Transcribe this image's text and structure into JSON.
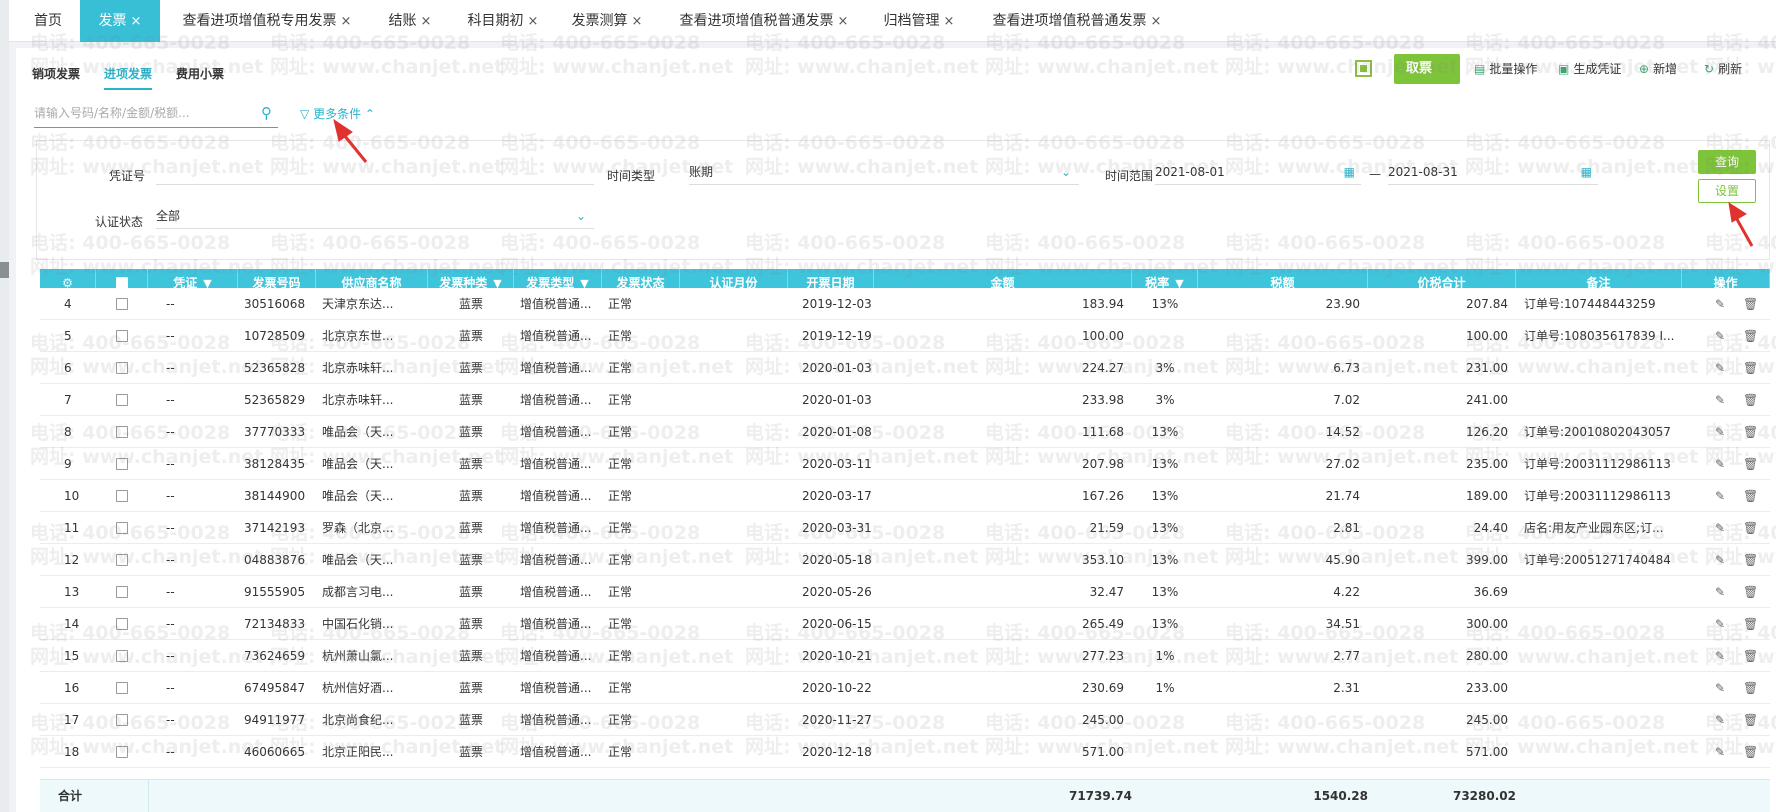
{
  "tabs": [
    {
      "label": "首页",
      "closable": false
    },
    {
      "label": "发票",
      "closable": true,
      "active": true
    },
    {
      "label": "查看进项增值税专用发票",
      "closable": true
    },
    {
      "label": "结账",
      "closable": true
    },
    {
      "label": "科目期初",
      "closable": true
    },
    {
      "label": "发票测算",
      "closable": true
    },
    {
      "label": "查看进项增值税普通发票",
      "closable": true
    },
    {
      "label": "归档管理",
      "closable": true
    },
    {
      "label": "查看进项增值税普通发票",
      "closable": true
    }
  ],
  "close_glyph": "×",
  "subtabs": [
    "销项发票",
    "进项发票",
    "费用小票"
  ],
  "toolbar": {
    "qr_icon": "qr-code-icon",
    "fetch_label": "取票",
    "fetch_caret": "⌄",
    "batch_label": "批量操作",
    "voucher_label": "生成凭证",
    "add_label": "新增",
    "refresh_label": "刷新"
  },
  "search": {
    "placeholder": "请输入号码/名称/金额/税额..."
  },
  "more_conditions": "更多条件",
  "filters": {
    "voucher_no_label": "凭证号",
    "time_type_label": "时间类型",
    "time_type_value": "账期",
    "time_range_label": "时间范围",
    "date_from": "2021-08-01",
    "date_sep": "—",
    "date_to": "2021-08-31",
    "cert_status_label": "认证状态",
    "cert_status_value": "全部",
    "query_button": "查询",
    "settings_button": "设置"
  },
  "table": {
    "headers": [
      "",
      "",
      "凭证",
      "发票号码",
      "供应商名称",
      "发票种类",
      "发票类型",
      "发票状态",
      "认证月份",
      "开票日期",
      "金额",
      "税率",
      "税额",
      "价税合计",
      "备注",
      "操作"
    ],
    "rows": [
      {
        "no": "4",
        "voucher": "--",
        "invoice_no": "30516068",
        "supplier": "天津京东达...",
        "kind": "蓝票",
        "type": "增值税普通...",
        "status": "正常",
        "month": "",
        "date": "2019-12-03",
        "amount": "183.94",
        "rate": "13%",
        "tax": "23.90",
        "total": "207.84",
        "note": "订单号:107448443259"
      },
      {
        "no": "5",
        "voucher": "--",
        "invoice_no": "10728509",
        "supplier": "北京京东世...",
        "kind": "蓝票",
        "type": "增值税普通...",
        "status": "正常",
        "month": "",
        "date": "2019-12-19",
        "amount": "100.00",
        "rate": "",
        "tax": "",
        "total": "100.00",
        "note": "订单号:108035617839 I..."
      },
      {
        "no": "6",
        "voucher": "--",
        "invoice_no": "52365828",
        "supplier": "北京赤味轩...",
        "kind": "蓝票",
        "type": "增值税普通...",
        "status": "正常",
        "month": "",
        "date": "2020-01-03",
        "amount": "224.27",
        "rate": "3%",
        "tax": "6.73",
        "total": "231.00",
        "note": ""
      },
      {
        "no": "7",
        "voucher": "--",
        "invoice_no": "52365829",
        "supplier": "北京赤味轩...",
        "kind": "蓝票",
        "type": "增值税普通...",
        "status": "正常",
        "month": "",
        "date": "2020-01-03",
        "amount": "233.98",
        "rate": "3%",
        "tax": "7.02",
        "total": "241.00",
        "note": ""
      },
      {
        "no": "8",
        "voucher": "--",
        "invoice_no": "37770333",
        "supplier": "唯品会（天...",
        "kind": "蓝票",
        "type": "增值税普通...",
        "status": "正常",
        "month": "",
        "date": "2020-01-08",
        "amount": "111.68",
        "rate": "13%",
        "tax": "14.52",
        "total": "126.20",
        "note": "订单号:20010802043057"
      },
      {
        "no": "9",
        "voucher": "--",
        "invoice_no": "38128435",
        "supplier": "唯品会（天...",
        "kind": "蓝票",
        "type": "增值税普通...",
        "status": "正常",
        "month": "",
        "date": "2020-03-11",
        "amount": "207.98",
        "rate": "13%",
        "tax": "27.02",
        "total": "235.00",
        "note": "订单号:20031112986113"
      },
      {
        "no": "10",
        "voucher": "--",
        "invoice_no": "38144900",
        "supplier": "唯品会（天...",
        "kind": "蓝票",
        "type": "增值税普通...",
        "status": "正常",
        "month": "",
        "date": "2020-03-17",
        "amount": "167.26",
        "rate": "13%",
        "tax": "21.74",
        "total": "189.00",
        "note": "订单号:20031112986113"
      },
      {
        "no": "11",
        "voucher": "--",
        "invoice_no": "37142193",
        "supplier": "罗森（北京...",
        "kind": "蓝票",
        "type": "增值税普通...",
        "status": "正常",
        "month": "",
        "date": "2020-03-31",
        "amount": "21.59",
        "rate": "13%",
        "tax": "2.81",
        "total": "24.40",
        "note": "店名:用友产业园东区;订..."
      },
      {
        "no": "12",
        "voucher": "--",
        "invoice_no": "04883876",
        "supplier": "唯品会（天...",
        "kind": "蓝票",
        "type": "增值税普通...",
        "status": "正常",
        "month": "",
        "date": "2020-05-18",
        "amount": "353.10",
        "rate": "13%",
        "tax": "45.90",
        "total": "399.00",
        "note": "订单号:20051271740484"
      },
      {
        "no": "13",
        "voucher": "--",
        "invoice_no": "91555905",
        "supplier": "成都言习电...",
        "kind": "蓝票",
        "type": "增值税普通...",
        "status": "正常",
        "month": "",
        "date": "2020-05-26",
        "amount": "32.47",
        "rate": "13%",
        "tax": "4.22",
        "total": "36.69",
        "note": ""
      },
      {
        "no": "14",
        "voucher": "--",
        "invoice_no": "72134833",
        "supplier": "中国石化销...",
        "kind": "蓝票",
        "type": "增值税普通...",
        "status": "正常",
        "month": "",
        "date": "2020-06-15",
        "amount": "265.49",
        "rate": "13%",
        "tax": "34.51",
        "total": "300.00",
        "note": ""
      },
      {
        "no": "15",
        "voucher": "--",
        "invoice_no": "73624659",
        "supplier": "杭州萧山氯...",
        "kind": "蓝票",
        "type": "增值税普通...",
        "status": "正常",
        "month": "",
        "date": "2020-10-21",
        "amount": "277.23",
        "rate": "1%",
        "tax": "2.77",
        "total": "280.00",
        "note": ""
      },
      {
        "no": "16",
        "voucher": "--",
        "invoice_no": "67495847",
        "supplier": "杭州信好酒...",
        "kind": "蓝票",
        "type": "增值税普通...",
        "status": "正常",
        "month": "",
        "date": "2020-10-22",
        "amount": "230.69",
        "rate": "1%",
        "tax": "2.31",
        "total": "233.00",
        "note": ""
      },
      {
        "no": "17",
        "voucher": "--",
        "invoice_no": "94911977",
        "supplier": "北京尚食纪...",
        "kind": "蓝票",
        "type": "增值税普通...",
        "status": "正常",
        "month": "",
        "date": "2020-11-27",
        "amount": "245.00",
        "rate": "",
        "tax": "",
        "total": "245.00",
        "note": ""
      },
      {
        "no": "18",
        "voucher": "--",
        "invoice_no": "46060665",
        "supplier": "北京正阳民...",
        "kind": "蓝票",
        "type": "增值税普通...",
        "status": "正常",
        "month": "",
        "date": "2020-12-18",
        "amount": "571.00",
        "rate": "",
        "tax": "",
        "total": "571.00",
        "note": ""
      }
    ],
    "footer": {
      "label": "合计",
      "amount": "71739.74",
      "tax": "1540.28",
      "total": "73280.02"
    }
  },
  "watermark": {
    "phone": "电话: 400-665-0028",
    "site": "网址: www.chanjet.net"
  },
  "colors": {
    "accent": "#38bfd6",
    "header": "#3ec5dc",
    "green": "#7ec43a",
    "arrow": "#e0322e"
  }
}
